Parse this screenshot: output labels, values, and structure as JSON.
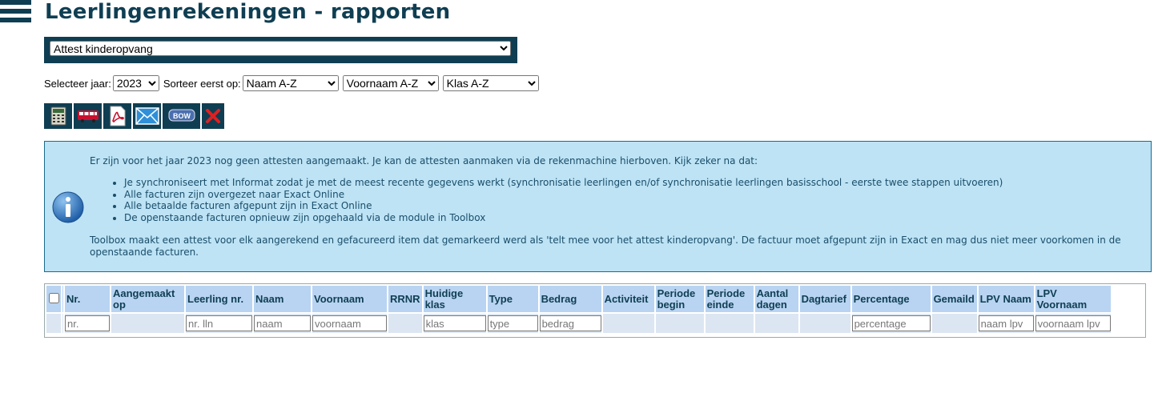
{
  "page": {
    "title": "Leerlingenrekeningen - rapporten",
    "report_selected": "Attest kinderopvang"
  },
  "filters": {
    "year_label": "Selecteer jaar:",
    "year_value": "2023",
    "sort_label": "Sorteer eerst op:",
    "sort1": "Naam A-Z",
    "sort2": "Voornaam A-Z",
    "sort3": "Klas A-Z"
  },
  "toolbar": {
    "icons": [
      "calculator-icon",
      "bus-icon",
      "pdf-icon",
      "mail-icon",
      "bow-icon",
      "delete-icon"
    ],
    "bow_label": "BOW"
  },
  "info": {
    "intro": "Er zijn voor het jaar 2023 nog geen attesten aangemaakt. Je kan de attesten aanmaken via de rekenmachine hierboven. Kijk zeker na dat:",
    "items": [
      "Je synchroniseert met Informat zodat je met de meest recente gegevens werkt (synchronisatie leerlingen en/of synchronisatie leerlingen basisschool - eerste twee stappen uitvoeren)",
      "Alle facturen zijn overgezet naar Exact Online",
      "Alle betaalde facturen afgepunt zijn in Exact Online",
      "De openstaande facturen opnieuw zijn opgehaald via de module in Toolbox"
    ],
    "footer": "Toolbox maakt een attest voor elk aangerekend en gefacureerd item dat gemarkeerd werd als 'telt mee voor het attest kinderopvang'. De factuur moet afgepunt zijn in Exact en mag dus niet meer voorkomen in de openstaande facturen."
  },
  "table": {
    "columns": [
      "Nr.",
      "Aangemaakt op",
      "Leerling nr.",
      "Naam",
      "Voornaam",
      "RRNR",
      "Huidige klas",
      "Type",
      "Bedrag",
      "Activiteit",
      "Periode begin",
      "Periode einde",
      "Aantal dagen",
      "Dagtarief",
      "Percentage",
      "Gemaild",
      "LPV Naam",
      "LPV Voornaam"
    ],
    "filter_placeholders": {
      "nr": "nr.",
      "leerling_nr": "nr. lln",
      "naam": "naam",
      "voornaam": "voornaam",
      "klas": "klas",
      "type": "type",
      "bedrag": "bedrag",
      "percentage": "percentage",
      "lpv_naam": "naam lpv",
      "lpv_voornaam": "voornaam lpv"
    }
  },
  "colors": {
    "brand": "#0f3e52",
    "info_bg": "#bde3f5",
    "header_bg": "#b8d4f2",
    "filter_bg": "#dce6f2"
  }
}
